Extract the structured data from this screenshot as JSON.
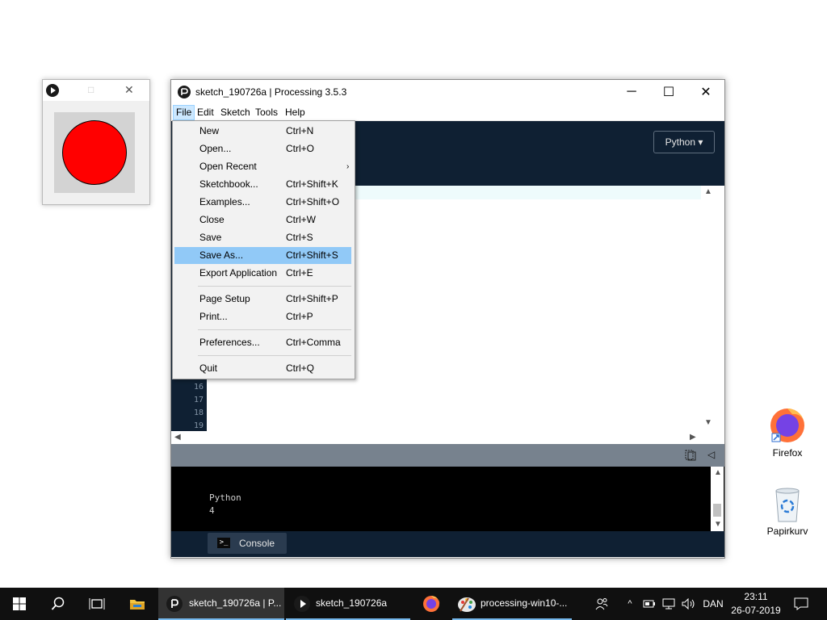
{
  "sketch_window": {
    "title": "",
    "icon": "processing-run-icon",
    "min": "□",
    "close": "✕",
    "canvas_bg": "#d3d3d3",
    "circle_color": "#ff0000"
  },
  "main_window": {
    "title": "sketch_190726a | Processing 3.5.3",
    "buttons": {
      "minimize": "─",
      "maximize": "☐",
      "close": "✕"
    },
    "menus": [
      "File",
      "Edit",
      "Sketch",
      "Tools",
      "Help"
    ],
    "mode": "Python ▾",
    "line_numbers": [
      "16",
      "17",
      "18",
      "19"
    ],
    "console_lines": [
      "Python",
      "4"
    ],
    "console_tab": "Console"
  },
  "file_menu": {
    "items": [
      {
        "label": "New",
        "shortcut": "Ctrl+N"
      },
      {
        "label": "Open...",
        "shortcut": "Ctrl+O"
      },
      {
        "label": "Open Recent",
        "shortcut": "",
        "submenu": "›"
      },
      {
        "label": "Sketchbook...",
        "shortcut": "Ctrl+Shift+K"
      },
      {
        "label": "Examples...",
        "shortcut": "Ctrl+Shift+O"
      },
      {
        "label": "Close",
        "shortcut": "Ctrl+W"
      },
      {
        "label": "Save",
        "shortcut": "Ctrl+S"
      },
      {
        "label": "Save As...",
        "shortcut": "Ctrl+Shift+S"
      },
      {
        "label": "Export Application",
        "shortcut": "Ctrl+E"
      },
      {
        "label": "Page Setup",
        "shortcut": "Ctrl+Shift+P"
      },
      {
        "label": "Print...",
        "shortcut": "Ctrl+P"
      },
      {
        "label": "Preferences...",
        "shortcut": "Ctrl+Comma"
      },
      {
        "label": "Quit",
        "shortcut": "Ctrl+Q"
      }
    ]
  },
  "desktop": {
    "firefox": "Firefox",
    "recycle": "Papirkurv"
  },
  "taskbar": {
    "apps": [
      {
        "label": "sketch_190726a | P..."
      },
      {
        "label": "sketch_190726a"
      },
      {
        "label": "processing-win10-..."
      }
    ],
    "language": "DAN",
    "time": "23:11",
    "date": "26-07-2019"
  },
  "colors": {
    "accent": "#91c9f7",
    "editor_dark": "#0f2033",
    "taskbar": "#101010"
  }
}
